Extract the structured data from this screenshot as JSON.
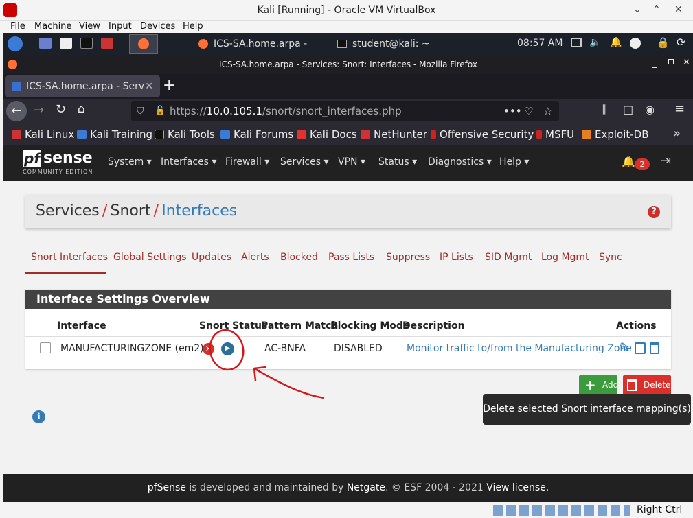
{
  "vbox": {
    "title": "Kali [Running] - Oracle VM VirtualBox",
    "menu": [
      "File",
      "Machine",
      "View",
      "Input",
      "Devices",
      "Help"
    ],
    "host_key": "Right Ctrl"
  },
  "taskbar": {
    "firefox_window": "ICS-SA.home.arpa - Ser...",
    "terminal_window": "student@kali: ~",
    "clock": "08:57 AM"
  },
  "firefox": {
    "window_title": "ICS-SA.home.arpa - Services: Snort: Interfaces - Mozilla Firefox",
    "tab_title": "ICS-SA.home.arpa - Serv",
    "url": "https://10.0.105.1/snort/snort_interfaces.php",
    "url_host": "10.0.105.1",
    "url_prefix": "https://",
    "url_path": "/snort/snort_interfaces.php",
    "bookmarks": [
      "Kali Linux",
      "Kali Training",
      "Kali Tools",
      "Kali Forums",
      "Kali Docs",
      "NetHunter",
      "Offensive Security",
      "MSFU",
      "Exploit-DB"
    ]
  },
  "pfsense": {
    "logo_pf": "pf",
    "logo_sense": "sense",
    "edition": "COMMUNITY EDITION",
    "menu": [
      "System",
      "Interfaces",
      "Firewall",
      "Services",
      "VPN",
      "Status",
      "Diagnostics",
      "Help"
    ],
    "notifications": "2"
  },
  "breadcrumb": {
    "part1": "Services",
    "part2": "Snort",
    "part3": "Interfaces",
    "sep": "/"
  },
  "tabs": [
    "Snort Interfaces",
    "Global Settings",
    "Updates",
    "Alerts",
    "Blocked",
    "Pass Lists",
    "Suppress",
    "IP Lists",
    "SID Mgmt",
    "Log Mgmt",
    "Sync"
  ],
  "panel": {
    "title": "Interface Settings Overview",
    "columns": [
      "Interface",
      "Snort Status",
      "Pattern Match",
      "Blocking Mode",
      "Description",
      "Actions"
    ],
    "rows": [
      {
        "interface": "MANUFACTURINGZONE (em2)",
        "pattern_match": "AC-BNFA",
        "blocking_mode": "DISABLED",
        "description": "Monitor traffic to/from the Manufacturing Zone"
      }
    ]
  },
  "buttons": {
    "add": "Add",
    "delete": "Delete"
  },
  "tooltip": "Delete selected Snort interface mapping(s)",
  "footer": {
    "brand": "pfSense",
    "text1": " is developed and maintained by ",
    "company": "Netgate",
    "text2": ". © ESF 2004 - 2021 ",
    "license": "View license."
  },
  "colors": {
    "accent_red": "#a32b26",
    "link_blue": "#337ab7",
    "add_green": "#3c9b3c",
    "delete_red": "#d9302b"
  }
}
